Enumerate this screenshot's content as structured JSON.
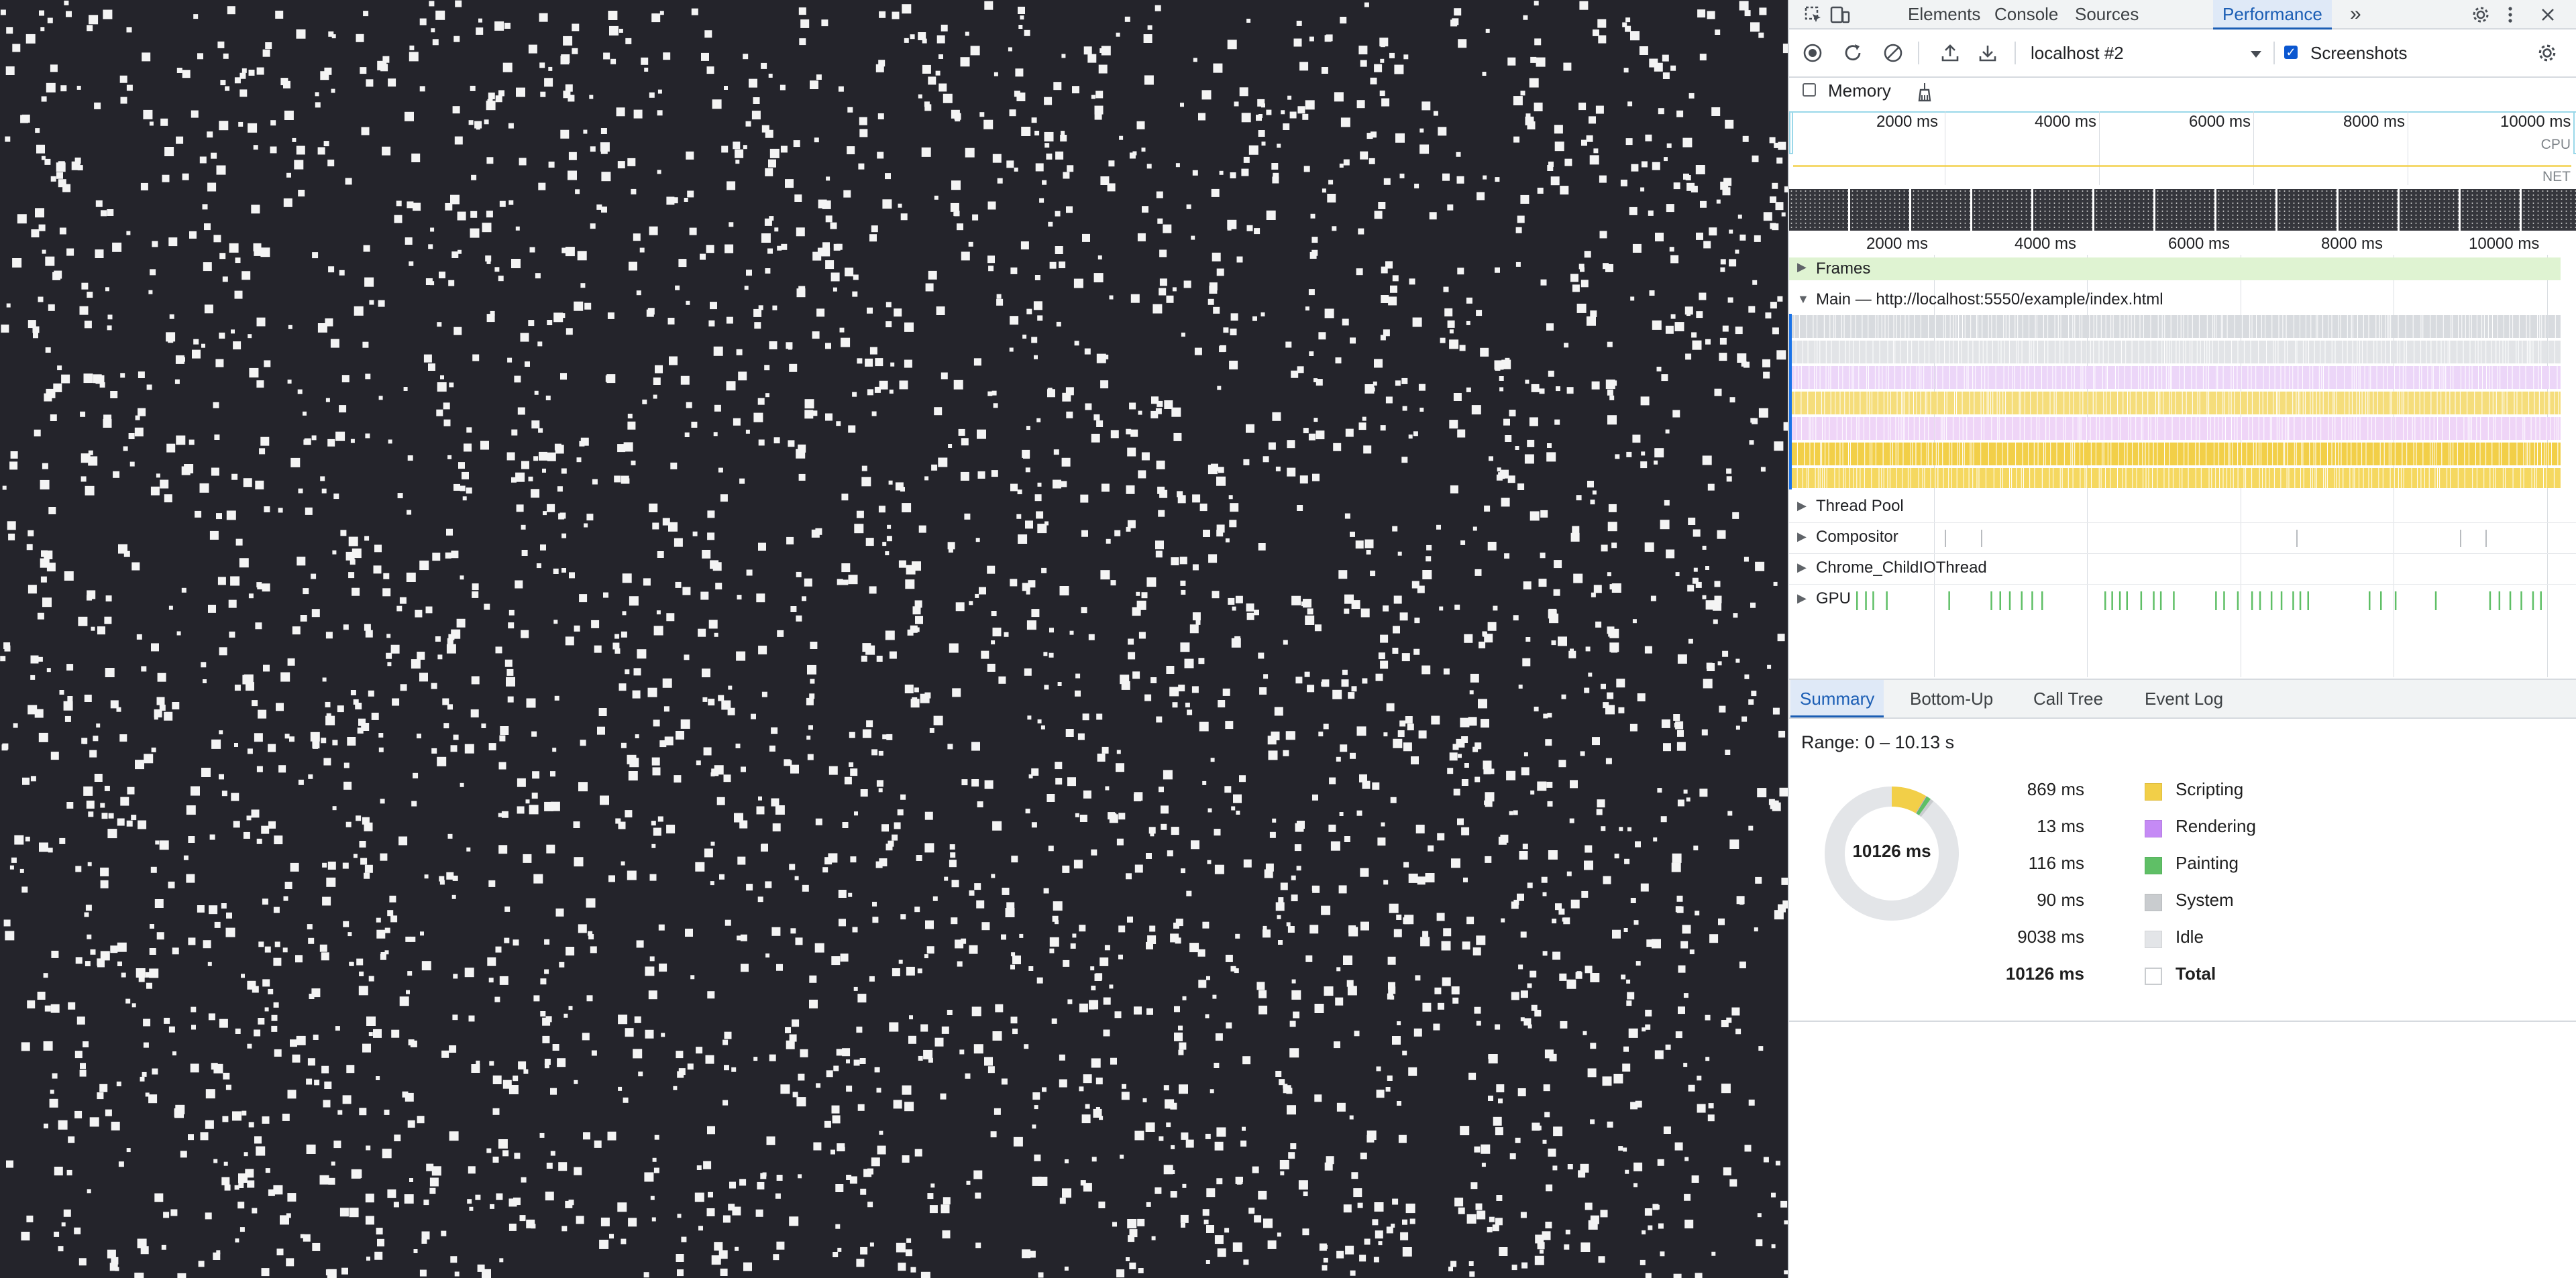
{
  "colors": {
    "accent": "#1a5db4",
    "scripting": "#f2cf48",
    "rendering": "#c58af5",
    "painting": "#5fbf66",
    "system": "#c9cccf",
    "idle": "#e3e5e8",
    "gpu": "#5fbf66",
    "viewport_bg": "#24242b"
  },
  "tabbar": {
    "icons": [
      "inspect-element-icon",
      "device-toolbar-icon"
    ],
    "tabs": [
      "Elements",
      "Console",
      "Sources",
      "Performance"
    ],
    "active_tab": "Performance",
    "more_tabs": "»",
    "settings_icon": "gear-icon",
    "kebab_icon": "more-vertical-icon",
    "close_icon": "close-icon"
  },
  "toolbar": {
    "target": "localhost #2",
    "screenshots_label": "Screenshots",
    "screenshots_checked": true,
    "memory_label": "Memory",
    "memory_checked": false
  },
  "overview": {
    "ticks": [
      "2000 ms",
      "4000 ms",
      "6000 ms",
      "8000 ms",
      "10000 ms"
    ],
    "cpu_label": "CPU",
    "net_label": "NET"
  },
  "timeline": {
    "ticks": [
      "2000 ms",
      "4000 ms",
      "6000 ms",
      "8000 ms",
      "10000 ms"
    ]
  },
  "tracks": {
    "frames": "Frames",
    "main": "Main — http://localhost:5550/example/index.html",
    "thread_pool": "Thread Pool",
    "compositor": "Compositor",
    "childio": "Chrome_ChildIOThread",
    "gpu": "GPU"
  },
  "bottom": {
    "tabs": [
      "Summary",
      "Bottom-Up",
      "Call Tree",
      "Event Log"
    ],
    "active_tab": "Summary",
    "range": "Range: 0 – 10.13 s",
    "donut_total": "10126 ms"
  },
  "summary": [
    {
      "value": "869 ms",
      "name": "Scripting",
      "ms": 869,
      "color": "#f2cf48"
    },
    {
      "value": "13 ms",
      "name": "Rendering",
      "ms": 13,
      "color": "#c58af5"
    },
    {
      "value": "116 ms",
      "name": "Painting",
      "ms": 116,
      "color": "#5fbf66"
    },
    {
      "value": "90 ms",
      "name": "System",
      "ms": 90,
      "color": "#c9cccf"
    },
    {
      "value": "9038 ms",
      "name": "Idle",
      "ms": 9038,
      "color": "#e3e5e8"
    },
    {
      "value": "10126 ms",
      "name": "Total",
      "ms": 10126,
      "color": "#ffffff"
    }
  ]
}
